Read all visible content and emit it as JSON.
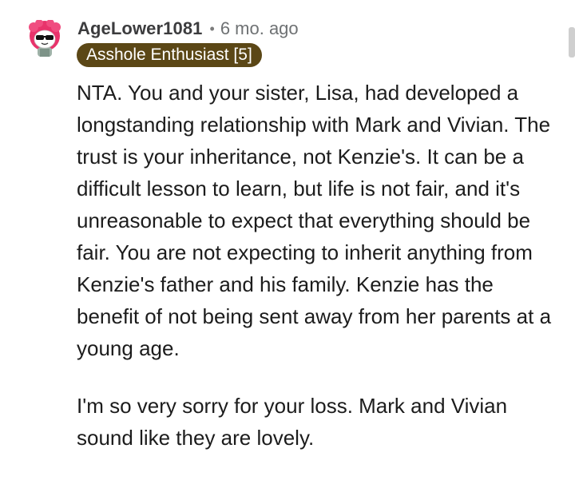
{
  "comment": {
    "username": "AgeLower1081",
    "separator": "•",
    "timestamp": "6 mo. ago",
    "flair": "Asshole Enthusiast [5]",
    "avatar_icon": "snoo-avatar-icon",
    "paragraphs": [
      "NTA. You and your sister, Lisa, had developed a longstanding relationship with Mark and Vivian. The trust is your inheritance, not Kenzie's. It can be a difficult lesson to learn, but life is not fair, and it's unreasonable to expect that everything should be fair. You are not expecting to inherit anything from Kenzie's father and his family. Kenzie has the benefit of not being sent away from her parents at a young age.",
      "I'm so very sorry for your loss. Mark and Vivian sound like they are lovely."
    ]
  },
  "colors": {
    "flair_background": "#5b4716",
    "avatar_hair": "#e8336b",
    "username": "#3c3c3e",
    "timestamp": "#6e7173"
  }
}
